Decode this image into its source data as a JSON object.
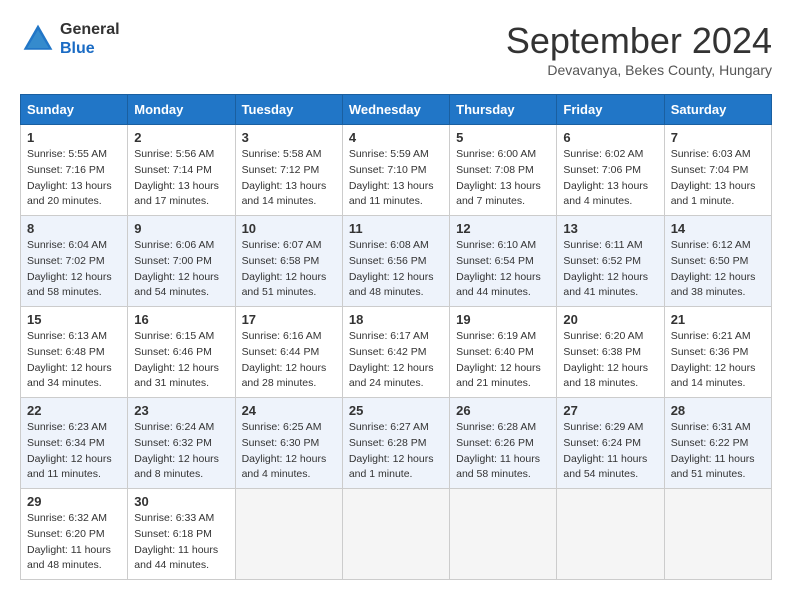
{
  "header": {
    "logo_general": "General",
    "logo_blue": "Blue",
    "month_title": "September 2024",
    "subtitle": "Devavanya, Bekes County, Hungary"
  },
  "columns": [
    "Sunday",
    "Monday",
    "Tuesday",
    "Wednesday",
    "Thursday",
    "Friday",
    "Saturday"
  ],
  "weeks": [
    {
      "shaded": false,
      "days": [
        {
          "num": "1",
          "info": "Sunrise: 5:55 AM\nSunset: 7:16 PM\nDaylight: 13 hours and 20 minutes."
        },
        {
          "num": "2",
          "info": "Sunrise: 5:56 AM\nSunset: 7:14 PM\nDaylight: 13 hours and 17 minutes."
        },
        {
          "num": "3",
          "info": "Sunrise: 5:58 AM\nSunset: 7:12 PM\nDaylight: 13 hours and 14 minutes."
        },
        {
          "num": "4",
          "info": "Sunrise: 5:59 AM\nSunset: 7:10 PM\nDaylight: 13 hours and 11 minutes."
        },
        {
          "num": "5",
          "info": "Sunrise: 6:00 AM\nSunset: 7:08 PM\nDaylight: 13 hours and 7 minutes."
        },
        {
          "num": "6",
          "info": "Sunrise: 6:02 AM\nSunset: 7:06 PM\nDaylight: 13 hours and 4 minutes."
        },
        {
          "num": "7",
          "info": "Sunrise: 6:03 AM\nSunset: 7:04 PM\nDaylight: 13 hours and 1 minute."
        }
      ]
    },
    {
      "shaded": true,
      "days": [
        {
          "num": "8",
          "info": "Sunrise: 6:04 AM\nSunset: 7:02 PM\nDaylight: 12 hours and 58 minutes."
        },
        {
          "num": "9",
          "info": "Sunrise: 6:06 AM\nSunset: 7:00 PM\nDaylight: 12 hours and 54 minutes."
        },
        {
          "num": "10",
          "info": "Sunrise: 6:07 AM\nSunset: 6:58 PM\nDaylight: 12 hours and 51 minutes."
        },
        {
          "num": "11",
          "info": "Sunrise: 6:08 AM\nSunset: 6:56 PM\nDaylight: 12 hours and 48 minutes."
        },
        {
          "num": "12",
          "info": "Sunrise: 6:10 AM\nSunset: 6:54 PM\nDaylight: 12 hours and 44 minutes."
        },
        {
          "num": "13",
          "info": "Sunrise: 6:11 AM\nSunset: 6:52 PM\nDaylight: 12 hours and 41 minutes."
        },
        {
          "num": "14",
          "info": "Sunrise: 6:12 AM\nSunset: 6:50 PM\nDaylight: 12 hours and 38 minutes."
        }
      ]
    },
    {
      "shaded": false,
      "days": [
        {
          "num": "15",
          "info": "Sunrise: 6:13 AM\nSunset: 6:48 PM\nDaylight: 12 hours and 34 minutes."
        },
        {
          "num": "16",
          "info": "Sunrise: 6:15 AM\nSunset: 6:46 PM\nDaylight: 12 hours and 31 minutes."
        },
        {
          "num": "17",
          "info": "Sunrise: 6:16 AM\nSunset: 6:44 PM\nDaylight: 12 hours and 28 minutes."
        },
        {
          "num": "18",
          "info": "Sunrise: 6:17 AM\nSunset: 6:42 PM\nDaylight: 12 hours and 24 minutes."
        },
        {
          "num": "19",
          "info": "Sunrise: 6:19 AM\nSunset: 6:40 PM\nDaylight: 12 hours and 21 minutes."
        },
        {
          "num": "20",
          "info": "Sunrise: 6:20 AM\nSunset: 6:38 PM\nDaylight: 12 hours and 18 minutes."
        },
        {
          "num": "21",
          "info": "Sunrise: 6:21 AM\nSunset: 6:36 PM\nDaylight: 12 hours and 14 minutes."
        }
      ]
    },
    {
      "shaded": true,
      "days": [
        {
          "num": "22",
          "info": "Sunrise: 6:23 AM\nSunset: 6:34 PM\nDaylight: 12 hours and 11 minutes."
        },
        {
          "num": "23",
          "info": "Sunrise: 6:24 AM\nSunset: 6:32 PM\nDaylight: 12 hours and 8 minutes."
        },
        {
          "num": "24",
          "info": "Sunrise: 6:25 AM\nSunset: 6:30 PM\nDaylight: 12 hours and 4 minutes."
        },
        {
          "num": "25",
          "info": "Sunrise: 6:27 AM\nSunset: 6:28 PM\nDaylight: 12 hours and 1 minute."
        },
        {
          "num": "26",
          "info": "Sunrise: 6:28 AM\nSunset: 6:26 PM\nDaylight: 11 hours and 58 minutes."
        },
        {
          "num": "27",
          "info": "Sunrise: 6:29 AM\nSunset: 6:24 PM\nDaylight: 11 hours and 54 minutes."
        },
        {
          "num": "28",
          "info": "Sunrise: 6:31 AM\nSunset: 6:22 PM\nDaylight: 11 hours and 51 minutes."
        }
      ]
    },
    {
      "shaded": false,
      "days": [
        {
          "num": "29",
          "info": "Sunrise: 6:32 AM\nSunset: 6:20 PM\nDaylight: 11 hours and 48 minutes."
        },
        {
          "num": "30",
          "info": "Sunrise: 6:33 AM\nSunset: 6:18 PM\nDaylight: 11 hours and 44 minutes."
        },
        {
          "num": "",
          "info": ""
        },
        {
          "num": "",
          "info": ""
        },
        {
          "num": "",
          "info": ""
        },
        {
          "num": "",
          "info": ""
        },
        {
          "num": "",
          "info": ""
        }
      ]
    }
  ]
}
